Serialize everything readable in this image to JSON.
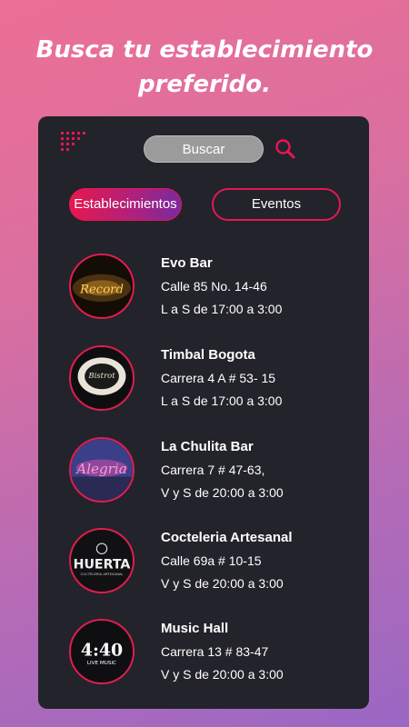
{
  "headline": {
    "line1": "Busca tu establecimiento",
    "line2": "preferido."
  },
  "search": {
    "label": "Buscar"
  },
  "tabs": [
    {
      "label": "Establecimientos",
      "active": true
    },
    {
      "label": "Eventos",
      "active": false
    }
  ],
  "venues": [
    {
      "name": "Evo Bar",
      "address": "Calle 85 No. 14-46",
      "hours": "L  a S de 17:00 a 3:00",
      "logo_text": "Record"
    },
    {
      "name": "Timbal Bogota",
      "address": "Carrera 4 A # 53- 15",
      "hours": "L  a S de 17:00 a 3:00",
      "logo_text": "Bistrot"
    },
    {
      "name": "La Chulita Bar",
      "address": "Carrera 7 # 47-63,",
      "hours": "V  y S de 20:00 a 3:00",
      "logo_text": "Alegria"
    },
    {
      "name": "Cocteleria Artesanal",
      "address": "Calle 69a # 10-15",
      "hours": "V  y S de 20:00 a 3:00",
      "logo_text": "HUERTA",
      "logo_subtext": "COCTELERIA ARTESANAL"
    },
    {
      "name": "Music Hall",
      "address": "Carrera 13 # 83-47",
      "hours": "V  y S de 20:00 a 3:00",
      "logo_text": "4:40",
      "logo_subtext": "LIVE MUSIC"
    }
  ],
  "colors": {
    "accent": "#e8174f",
    "panel": "#23232b",
    "search_bg": "#9b9b9b"
  },
  "icons": [
    "grid-dots-icon",
    "search-icon"
  ]
}
